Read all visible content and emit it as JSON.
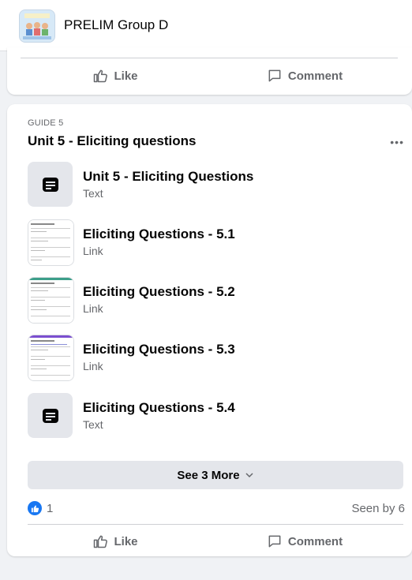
{
  "header": {
    "group_name": "PRELIM Group D"
  },
  "top_post_actions": {
    "like_label": "Like",
    "comment_label": "Comment"
  },
  "guide": {
    "label": "GUIDE 5",
    "title": "Unit 5 - Eliciting questions",
    "more_icon": "more-horizontal-icon",
    "items": [
      {
        "title": "Unit 5 - Eliciting Questions",
        "type": "Text",
        "icon": "document-icon"
      },
      {
        "title": "Eliciting Questions - 5.1",
        "type": "Link",
        "icon": "document-thumbnail"
      },
      {
        "title": "Eliciting Questions - 5.2",
        "type": "Link",
        "icon": "document-thumbnail"
      },
      {
        "title": "Eliciting Questions - 5.3",
        "type": "Link",
        "icon": "document-thumbnail"
      },
      {
        "title": "Eliciting Questions - 5.4",
        "type": "Text",
        "icon": "document-icon"
      }
    ],
    "see_more_label": "See 3 More",
    "reaction_count": "1",
    "seen_by": "Seen by 6",
    "like_label": "Like",
    "comment_label": "Comment"
  },
  "colors": {
    "brand_blue": "#1877f2",
    "secondary_text": "#65676b",
    "background": "#f0f2f5"
  }
}
